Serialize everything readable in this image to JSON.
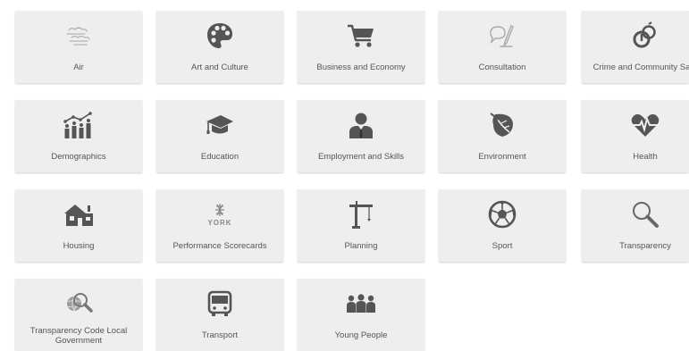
{
  "tiles": [
    {
      "label": "Air",
      "icon": "clouds-icon",
      "icon_color": "#b4b4b4"
    },
    {
      "label": "Art and Culture",
      "icon": "palette-icon",
      "icon_color": "#555555"
    },
    {
      "label": "Business and Economy",
      "icon": "shopping-cart-icon",
      "icon_color": "#555555"
    },
    {
      "label": "Consultation",
      "icon": "speech-bubble-pen-icon",
      "icon_color": "#aaaaaa"
    },
    {
      "label": "Crime and Community Safe",
      "icon": "handcuffs-icon",
      "icon_color": "#555555"
    },
    {
      "label": "Demographics",
      "icon": "people-bar-chart-icon",
      "icon_color": "#555555"
    },
    {
      "label": "Education",
      "icon": "graduation-cap-icon",
      "icon_color": "#555555"
    },
    {
      "label": "Employment and Skills",
      "icon": "businessman-icon",
      "icon_color": "#555555"
    },
    {
      "label": "Environment",
      "icon": "leaf-icon",
      "icon_color": "#555555"
    },
    {
      "label": "Health",
      "icon": "heart-pulse-icon",
      "icon_color": "#555555"
    },
    {
      "label": "Housing",
      "icon": "house-icon",
      "icon_color": "#555555"
    },
    {
      "label": "Performance Scorecards",
      "icon": "york-logo-icon",
      "icon_color": "#888888",
      "logo_text": "YORK"
    },
    {
      "label": "Planning",
      "icon": "crane-icon",
      "icon_color": "#555555"
    },
    {
      "label": "Sport",
      "icon": "football-icon",
      "icon_color": "#555555"
    },
    {
      "label": "Transparency",
      "icon": "magnifier-icon",
      "icon_color": "#666666"
    },
    {
      "label": "Transparency Code Local Government",
      "icon": "globe-magnifier-icon",
      "icon_color": "#777777"
    },
    {
      "label": "Transport",
      "icon": "bus-icon",
      "icon_color": "#555555"
    },
    {
      "label": "Young People",
      "icon": "group-icon",
      "icon_color": "#555555"
    }
  ]
}
